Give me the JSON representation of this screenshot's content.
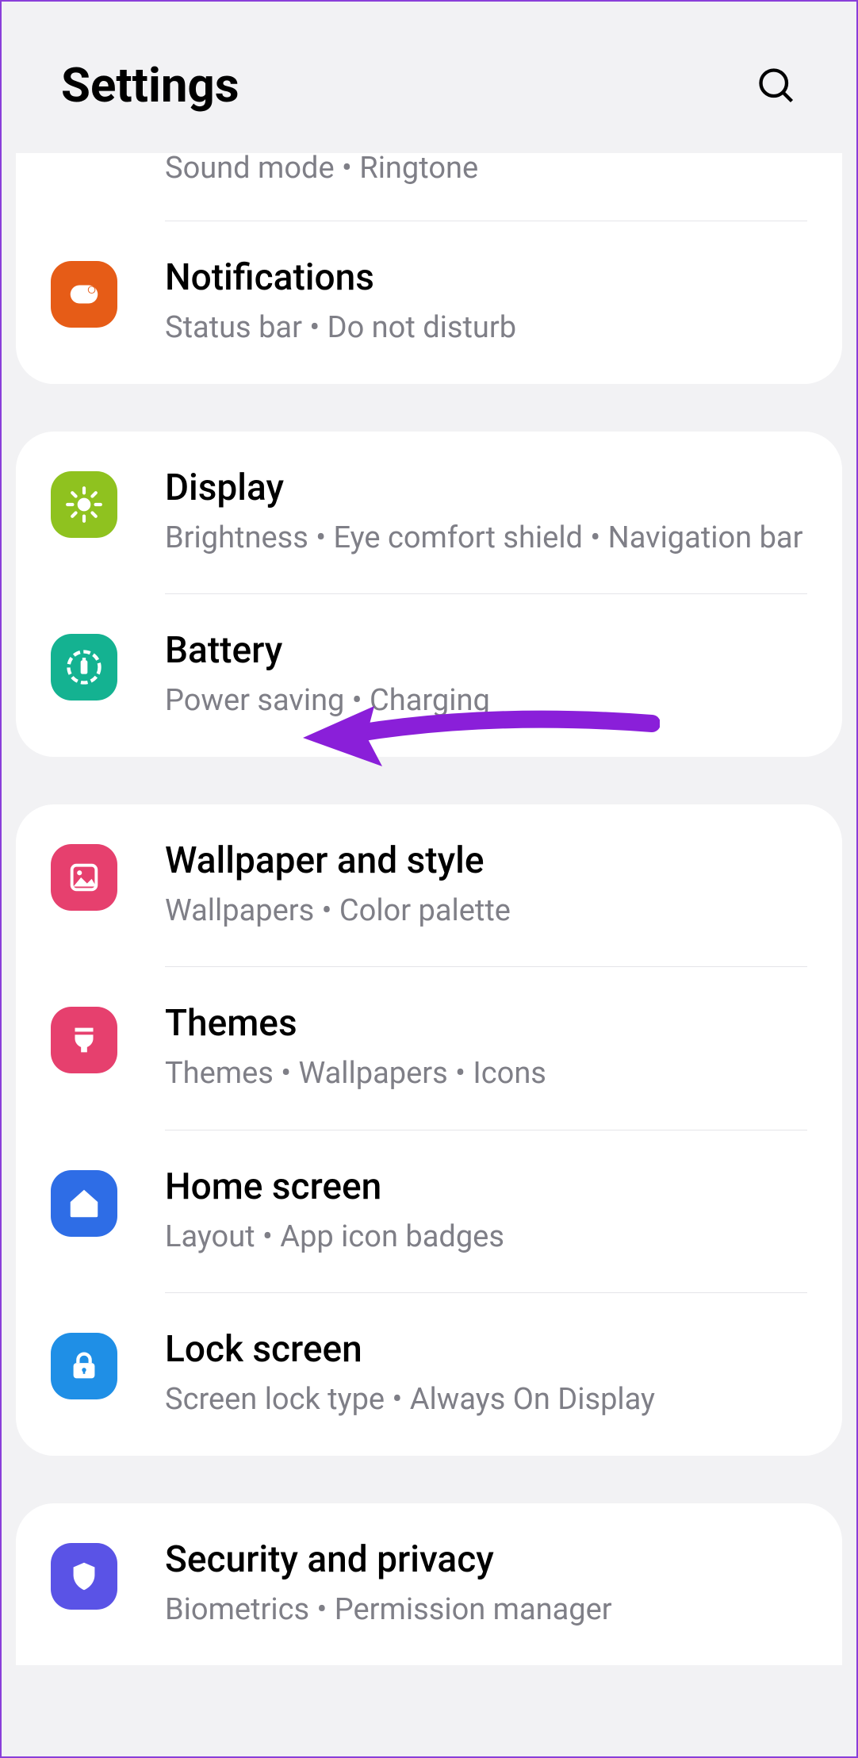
{
  "header": {
    "title": "Settings"
  },
  "group1": {
    "sounds": {
      "sub": "Sound mode  •  Ringtone"
    },
    "notifications": {
      "title": "Notifications",
      "sub": "Status bar  •  Do not disturb"
    }
  },
  "group2": {
    "display": {
      "title": "Display",
      "sub": "Brightness  •  Eye comfort shield  •  Navigation bar"
    },
    "battery": {
      "title": "Battery",
      "sub": "Power saving  •  Charging"
    }
  },
  "group3": {
    "wallpaper": {
      "title": "Wallpaper and style",
      "sub": "Wallpapers  •  Color palette"
    },
    "themes": {
      "title": "Themes",
      "sub": "Themes  •  Wallpapers  •  Icons"
    },
    "home": {
      "title": "Home screen",
      "sub": "Layout  •  App icon badges"
    },
    "lock": {
      "title": "Lock screen",
      "sub": "Screen lock type  •  Always On Display"
    }
  },
  "group4": {
    "security": {
      "title": "Security and privacy",
      "sub": "Biometrics  •  Permission manager"
    }
  }
}
